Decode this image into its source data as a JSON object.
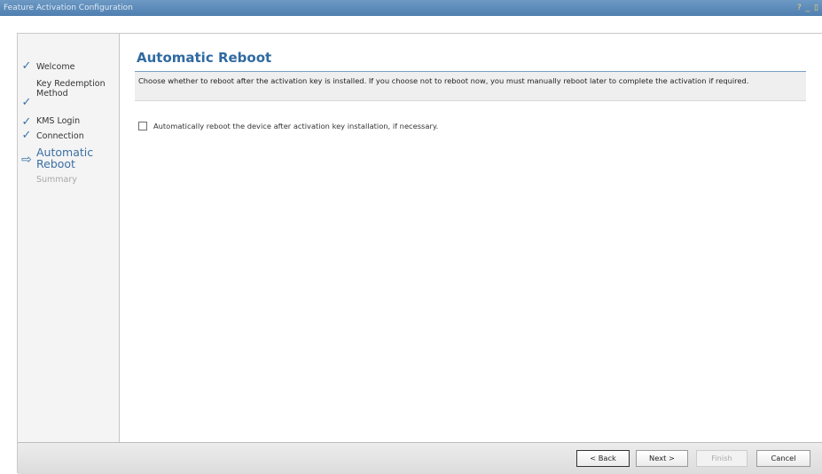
{
  "window": {
    "title": "Feature Activation Configuration",
    "controls": "? _ ▯"
  },
  "nav": {
    "items": [
      {
        "label": "Welcome",
        "state": "done"
      },
      {
        "label": "Key Redemption Method",
        "state": "done"
      },
      {
        "label": "KMS Login",
        "state": "done"
      },
      {
        "label": "Connection",
        "state": "done"
      },
      {
        "label": "Automatic Reboot",
        "state": "current"
      },
      {
        "label": "Summary",
        "state": "pending"
      }
    ]
  },
  "main": {
    "title": "Automatic Reboot",
    "description": "Choose whether to reboot after the activation key is installed. If you choose not to reboot now, you must manually reboot later to complete the activation if required.",
    "option": {
      "label": "Automatically reboot the device after activation key installation, if necessary.",
      "checked": false
    }
  },
  "footer": {
    "back_label": "< Back",
    "next_label": "Next >",
    "finish_label": "Finish",
    "cancel_label": "Cancel"
  },
  "icons": {
    "done": "check-icon",
    "current": "arrow-right-icon"
  },
  "colors": {
    "accent": "#2f6aa1",
    "titlebar": "#5a88b8",
    "nav_background": "#f4f4f4"
  }
}
